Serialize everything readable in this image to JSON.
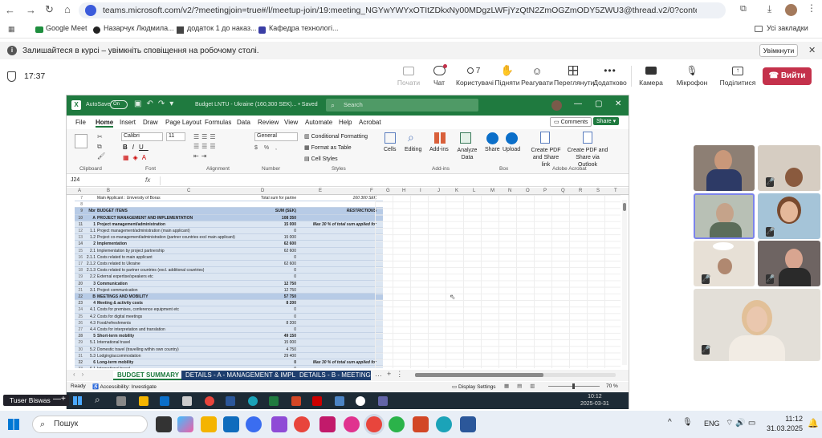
{
  "browser": {
    "url": "teams.microsoft.com/v2/?meetingjoin=true#/l/meetup-join/19:meeting_NGYwYWYxOTItZDkxNy00MDgzLWFjYzQtN2ZmOGZmODY5ZWU3@thread.v2/0?context=%7b\"Tid\"%3...",
    "bookmarks": [
      "Google Meet",
      "Назарчук Людмила...",
      "додаток 1 до наказ...",
      "Кафедра технологі..."
    ],
    "all_bookmarks": "Усі закладки"
  },
  "notice": {
    "text": "Залишайтеся в курсі – увімкніть сповіщення на робочому столі.",
    "button": "Увімкнути"
  },
  "meeting": {
    "time": "17:37",
    "buttons": [
      {
        "label": "Почати",
        "icon": "start-icon"
      },
      {
        "label": "Чат",
        "icon": "chat-icon"
      },
      {
        "label": "Користувачі",
        "icon": "people-icon",
        "count": "7"
      },
      {
        "label": "Підняти",
        "icon": "hand-icon"
      },
      {
        "label": "Реагувати",
        "icon": "smile-icon"
      },
      {
        "label": "Переглянути",
        "icon": "grid-icon"
      },
      {
        "label": "Додатково",
        "icon": "more-icon"
      }
    ],
    "devices": [
      {
        "label": "Камера",
        "icon": "camera-icon"
      },
      {
        "label": "Мікрофон",
        "icon": "mic-icon"
      },
      {
        "label": "Поділитися",
        "icon": "share-icon"
      }
    ],
    "leave": "Вийти",
    "accent": "#c4314b"
  },
  "excel": {
    "autosave": "AutoSave",
    "autosave_state": "On",
    "title": "Budget LNTU - Ukraine (160,300 SEK)... • Saved",
    "search": "Search",
    "tabs": [
      "File",
      "Home",
      "Insert",
      "Draw",
      "Page Layout",
      "Formulas",
      "Data",
      "Review",
      "View",
      "Automate",
      "Help",
      "Acrobat"
    ],
    "comments": "Comments",
    "share": "Share",
    "ribbon": {
      "font": "Calibri",
      "size": "11",
      "number_format": "General",
      "conditional": "Conditional Formatting",
      "format_table": "Format as Table",
      "cell_styles": "Cell Styles",
      "cells": "Cells",
      "editing": "Editing",
      "addins": "Add-ins",
      "analyze": "Analyze Data",
      "share_btn": "Share",
      "upload": "Upload",
      "create_pdf": "Create PDF and Share link",
      "create_pdf2": "Create PDF and Share via Outlook",
      "groups": [
        "Clipboard",
        "Font",
        "Alignment",
        "Number",
        "Styles",
        "Add-ins",
        "Box",
        "Adobe Acrobat"
      ]
    },
    "cell_ref": "J24",
    "fx": "fx",
    "columns": [
      "A",
      "B",
      "C",
      "D",
      "E",
      "F",
      "G",
      "H",
      "I",
      "J",
      "K",
      "L",
      "M",
      "N",
      "O",
      "P",
      "Q",
      "R",
      "S",
      "T"
    ],
    "rows": [
      {
        "n": "7",
        "a": "",
        "b": "Main Applicant : University of Boras",
        "d": "Total sum for partner",
        "e": "160 300 SEK"
      },
      {
        "n": "8",
        "a": "",
        "b": "",
        "d": "",
        "e": ""
      },
      {
        "n": "9",
        "a": "Nbr",
        "b": "BUDGET ITEMS",
        "d": "SUM (SEK)",
        "e": "RESTRICTIONS"
      },
      {
        "n": "10",
        "a": "A",
        "b": "PROJECT MANAGEMENT AND IMPLEMENTATION",
        "d": "108 350",
        "e": ""
      },
      {
        "n": "11",
        "a": "1",
        "b": "Project management/administration",
        "d": "15 000",
        "e": "Max 30 % of total sum applied for"
      },
      {
        "n": "12",
        "a": "1.1",
        "b": "Project management/administration (main applicant)",
        "d": "0",
        "e": ""
      },
      {
        "n": "13",
        "a": "1.2",
        "b": "Project co-management/administration (partner countries excl main applicant)",
        "d": "15 000",
        "e": ""
      },
      {
        "n": "14",
        "a": "2",
        "b": "Implementation",
        "d": "62 600",
        "e": ""
      },
      {
        "n": "15",
        "a": "2.1",
        "b": "Implementation by project partnership",
        "d": "62 600",
        "e": ""
      },
      {
        "n": "16",
        "a": "2.1.1",
        "b": "Costs related to main applicant",
        "d": "0",
        "e": ""
      },
      {
        "n": "17",
        "a": "2.1.2",
        "b": "Costs related to Ukraine",
        "d": "62 600",
        "e": ""
      },
      {
        "n": "18",
        "a": "2.1.3",
        "b": "Costs related to partner countries (excl. additional countries)",
        "d": "0",
        "e": ""
      },
      {
        "n": "19",
        "a": "2.2",
        "b": "External expertise/speakers etc",
        "d": "0",
        "e": ""
      },
      {
        "n": "20",
        "a": "3",
        "b": "Communication",
        "d": "12 750",
        "e": ""
      },
      {
        "n": "21",
        "a": "3.1",
        "b": "Project communication",
        "d": "12 750",
        "e": ""
      },
      {
        "n": "22",
        "a": "B",
        "b": "MEETINGS AND MOBILITY",
        "d": "57 750",
        "e": ""
      },
      {
        "n": "23",
        "a": "4",
        "b": "Meeting & activity costs",
        "d": "8 200",
        "e": ""
      },
      {
        "n": "24",
        "a": "4.1",
        "b": "Costs for premises, conference equipment etc",
        "d": "0",
        "e": ""
      },
      {
        "n": "25",
        "a": "4.2",
        "b": "Costs for digital meetings",
        "d": "0",
        "e": ""
      },
      {
        "n": "26",
        "a": "4.3",
        "b": "Food/refreshments",
        "d": "8 200",
        "e": ""
      },
      {
        "n": "27",
        "a": "4.4",
        "b": "Costs for interpretation and translation",
        "d": "0",
        "e": ""
      },
      {
        "n": "28",
        "a": "5",
        "b": "Short-term mobility",
        "d": "49 150",
        "e": ""
      },
      {
        "n": "29",
        "a": "5.1",
        "b": "International travel",
        "d": "15 000",
        "e": ""
      },
      {
        "n": "30",
        "a": "5.2",
        "b": "Domestic travel (travelling within own country)",
        "d": "4 750",
        "e": ""
      },
      {
        "n": "31",
        "a": "5.3",
        "b": "Lodging/accommodation",
        "d": "29 400",
        "e": ""
      },
      {
        "n": "32",
        "a": "6",
        "b": "Long-term mobility",
        "d": "0",
        "e": "Max 30 % of total sum applied for"
      },
      {
        "n": "33",
        "a": "6.1",
        "b": "International travel",
        "d": "0",
        "e": ""
      }
    ],
    "sheet_tabs": [
      "BUDGET SUMMARY",
      "DETAILS - A - MANAGEMENT & IMPL",
      "DETAILS - B - MEETINGS"
    ],
    "status": {
      "ready": "Ready",
      "accessibility": "Accessibility: Investigate",
      "display": "Display Settings",
      "zoom": "70 %"
    },
    "clock": {
      "time": "10:12",
      "date": "2025-03-31"
    }
  },
  "presenter": "Tuser Biswas",
  "taskbar": {
    "search": "Пошук",
    "lang": "ENG",
    "time": "11:12",
    "date": "31.03.2025"
  }
}
